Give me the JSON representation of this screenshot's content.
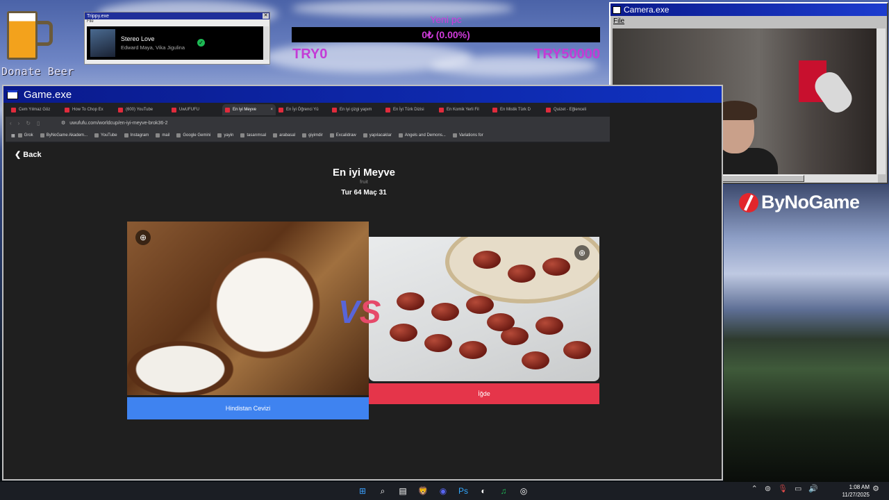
{
  "donate": {
    "label": "Donate Beer"
  },
  "trippy": {
    "title": "Trippy.exe",
    "menu": "File",
    "song": "Stereo Love",
    "artist": "Edward Maya, Vika Jigulina"
  },
  "goal": {
    "title": "Yeni pc",
    "progress_text": "0₺ (0.00%)",
    "progress": 0,
    "min": "TRY0",
    "max": "TRY50000",
    "color": "#d03bdb"
  },
  "camera": {
    "title": "Camera.exe",
    "menu": "File"
  },
  "brand": {
    "name": "ByNoGame",
    "color": "#e2262c"
  },
  "game": {
    "title": "Game.exe"
  },
  "browser": {
    "tabs": [
      {
        "label": "Cem Yılmaz Göz",
        "icon": "youtube-icon"
      },
      {
        "label": "How To Chop Ex",
        "icon": "youtube-icon"
      },
      {
        "label": "(600) YouTube",
        "icon": "youtube-icon"
      },
      {
        "label": "UwUFUFU",
        "icon": "uwufufu-icon"
      },
      {
        "label": "En iyi Meyve",
        "icon": "uwufufu-icon",
        "active": true
      },
      {
        "label": "En İyi Öğrenci Yü",
        "icon": "uwufufu-icon"
      },
      {
        "label": "En iyi çizgi yapım",
        "icon": "uwufufu-icon"
      },
      {
        "label": "En İyi Türk Dizisi",
        "icon": "uwufufu-icon"
      },
      {
        "label": "En Komik Yerli Fil",
        "icon": "uwufufu-icon"
      },
      {
        "label": "En Mistik Türk D",
        "icon": "uwufufu-icon"
      },
      {
        "label": "Quizet - Eğlenceli",
        "icon": "quizet-icon"
      }
    ],
    "url": "uwufufu.com/worldcup/en-iyi-meyve-brok36-2",
    "bookmarks": [
      "Grok",
      "ByNoGame Akadem...",
      "YouTube",
      "Instagram",
      "mail",
      "Google Gemini",
      "yayin",
      "tasarımsal",
      "arabasal",
      "giyimdir",
      "Excalidraw",
      "yapılacaklar",
      "Angels and Demons...",
      "Variations for"
    ]
  },
  "page": {
    "back": "Back",
    "title": "En iyi Meyve",
    "subtitle": "fruit",
    "round": "Tur 64 Maç 31",
    "vs_v": "V",
    "vs_s": "S",
    "left_choice": "Hindistan Cevizi",
    "right_choice": "İğde",
    "left_color": "#3f83f0",
    "right_color": "#e5354a"
  },
  "taskbar": {
    "time": "1:08 AM",
    "date": "11/27/2025",
    "icons": [
      "windows-icon",
      "search-icon",
      "file-explorer-icon",
      "brave-icon",
      "discord-icon",
      "photoshop-icon",
      "color-picker-icon",
      "spotify-icon",
      "obs-icon"
    ]
  }
}
